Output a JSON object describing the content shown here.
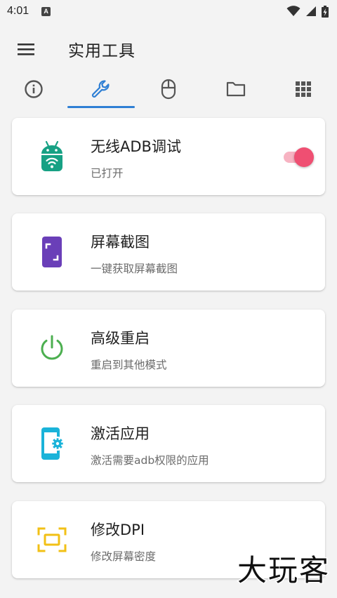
{
  "status_bar": {
    "time": "4:01",
    "notification_letter": "A"
  },
  "app_bar": {
    "title": "实用工具"
  },
  "tabs": [
    {
      "icon": "info-icon",
      "selected": false
    },
    {
      "icon": "wrench-icon",
      "selected": true
    },
    {
      "icon": "mouse-icon",
      "selected": false
    },
    {
      "icon": "folder-icon",
      "selected": false
    },
    {
      "icon": "grid-icon",
      "selected": false
    }
  ],
  "colors": {
    "accent": "#2f7fd4",
    "toggle_on": "#ef4f72",
    "android_teal": "#17a184",
    "screenshot_purple": "#6a3fb8",
    "power_green": "#4caf50",
    "activate_cyan": "#1ab3d9",
    "dpi_yellow": "#f2c016"
  },
  "cards": [
    {
      "title": "无线ADB调试",
      "subtitle": "已打开",
      "icon": "android-wifi-icon",
      "toggle_on": true
    },
    {
      "title": "屏幕截图",
      "subtitle": "一键获取屏幕截图",
      "icon": "screenshot-icon"
    },
    {
      "title": "高级重启",
      "subtitle": "重启到其他模式",
      "icon": "power-icon"
    },
    {
      "title": "激活应用",
      "subtitle": "激活需要adb权限的应用",
      "icon": "phone-gear-icon"
    },
    {
      "title": "修改DPI",
      "subtitle": "修改屏幕密度",
      "icon": "dpi-frame-icon"
    }
  ],
  "watermark": "大玩客"
}
